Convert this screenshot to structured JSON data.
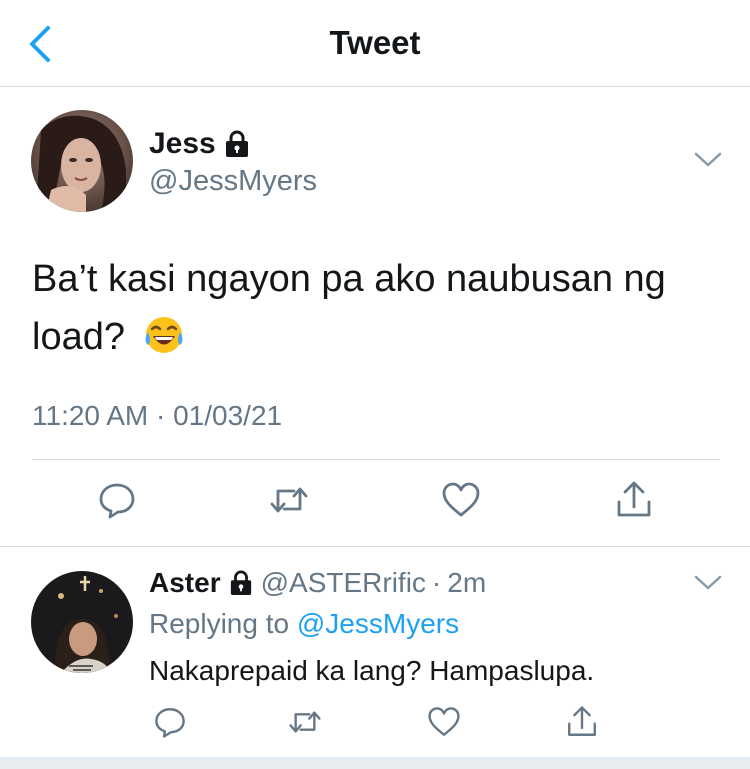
{
  "nav": {
    "title": "Tweet",
    "back_icon": "chevron-left-icon"
  },
  "main_tweet": {
    "name": "Jess",
    "handle": "@JessMyers",
    "text": "Ba’t kasi ngayon pa ako naubusan ng load?",
    "emoji": "face-with-tears-of-joy",
    "timestamp": "11:20 AM · 01/03/21",
    "locked": true
  },
  "reply": {
    "name": "Aster",
    "handle": "@ASTERrific",
    "separator": "·",
    "time": "2m",
    "replying_prefix": "Replying to",
    "replying_to": "@JessMyers",
    "text": "Nakaprepaid ka lang? Hampaslupa.",
    "locked": true
  },
  "colors": {
    "accent": "#1da1f2",
    "secondary_text": "#657786",
    "divider": "#d6dadd",
    "icon_gray": "#657786"
  }
}
